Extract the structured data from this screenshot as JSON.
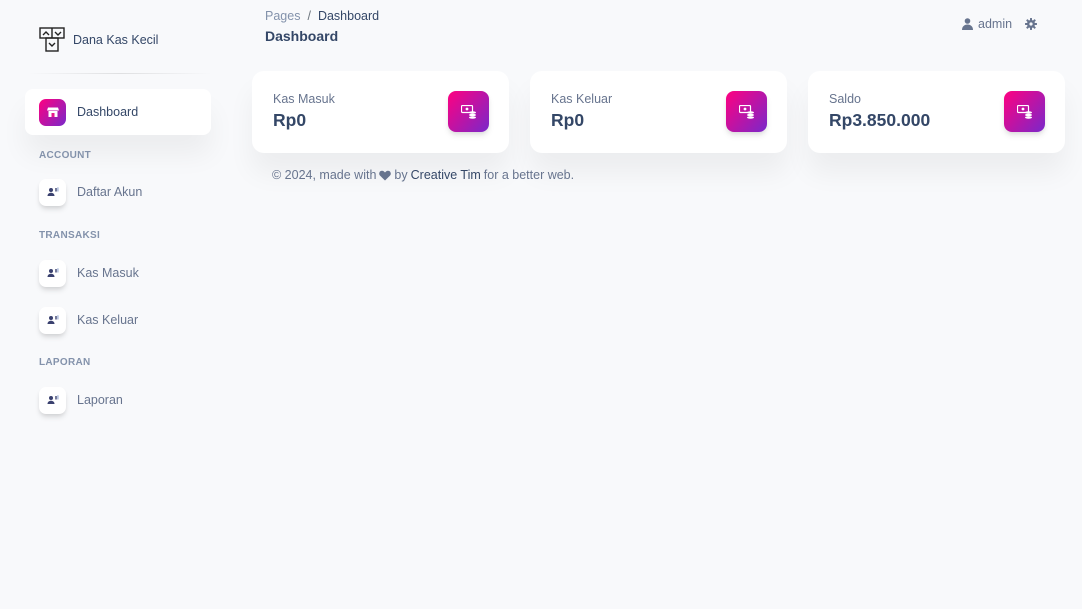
{
  "brand": {
    "name": "Dana Kas Kecil",
    "logo_icon": "cashbox-logo-icon"
  },
  "sidebar": {
    "items": [
      {
        "label": "Dashboard",
        "icon": "shop-icon",
        "active": true
      },
      {
        "label": "Daftar Akun",
        "icon": "users-icon"
      },
      {
        "label": "Kas Masuk",
        "icon": "users-icon"
      },
      {
        "label": "Kas Keluar",
        "icon": "users-icon"
      },
      {
        "label": "Laporan",
        "icon": "users-icon"
      }
    ],
    "sections": [
      "ACCOUNT",
      "TRANSAKSI",
      "LAPORAN"
    ]
  },
  "breadcrumb": {
    "parent": "Pages",
    "separator": "/",
    "current": "Dashboard"
  },
  "page_title": "Dashboard",
  "user": {
    "name": "admin",
    "icon": "user-icon",
    "settings_icon": "gear-icon"
  },
  "cards": [
    {
      "label": "Kas Masuk",
      "value": "Rp0",
      "icon": "money-coins-icon"
    },
    {
      "label": "Kas Keluar",
      "value": "Rp0",
      "icon": "money-coins-icon"
    },
    {
      "label": "Saldo",
      "value": "Rp3.850.000",
      "icon": "money-coins-icon"
    }
  ],
  "footer": {
    "prefix": "© 2024, made with",
    "by": "by",
    "author": "Creative Tim",
    "suffix": "for a better web."
  },
  "colors": {
    "accent_gradient_start": "#7928ca",
    "accent_gradient_end": "#ff0080",
    "text_dark": "#344767",
    "text_muted": "#67748e",
    "background": "#f8f9fb"
  }
}
